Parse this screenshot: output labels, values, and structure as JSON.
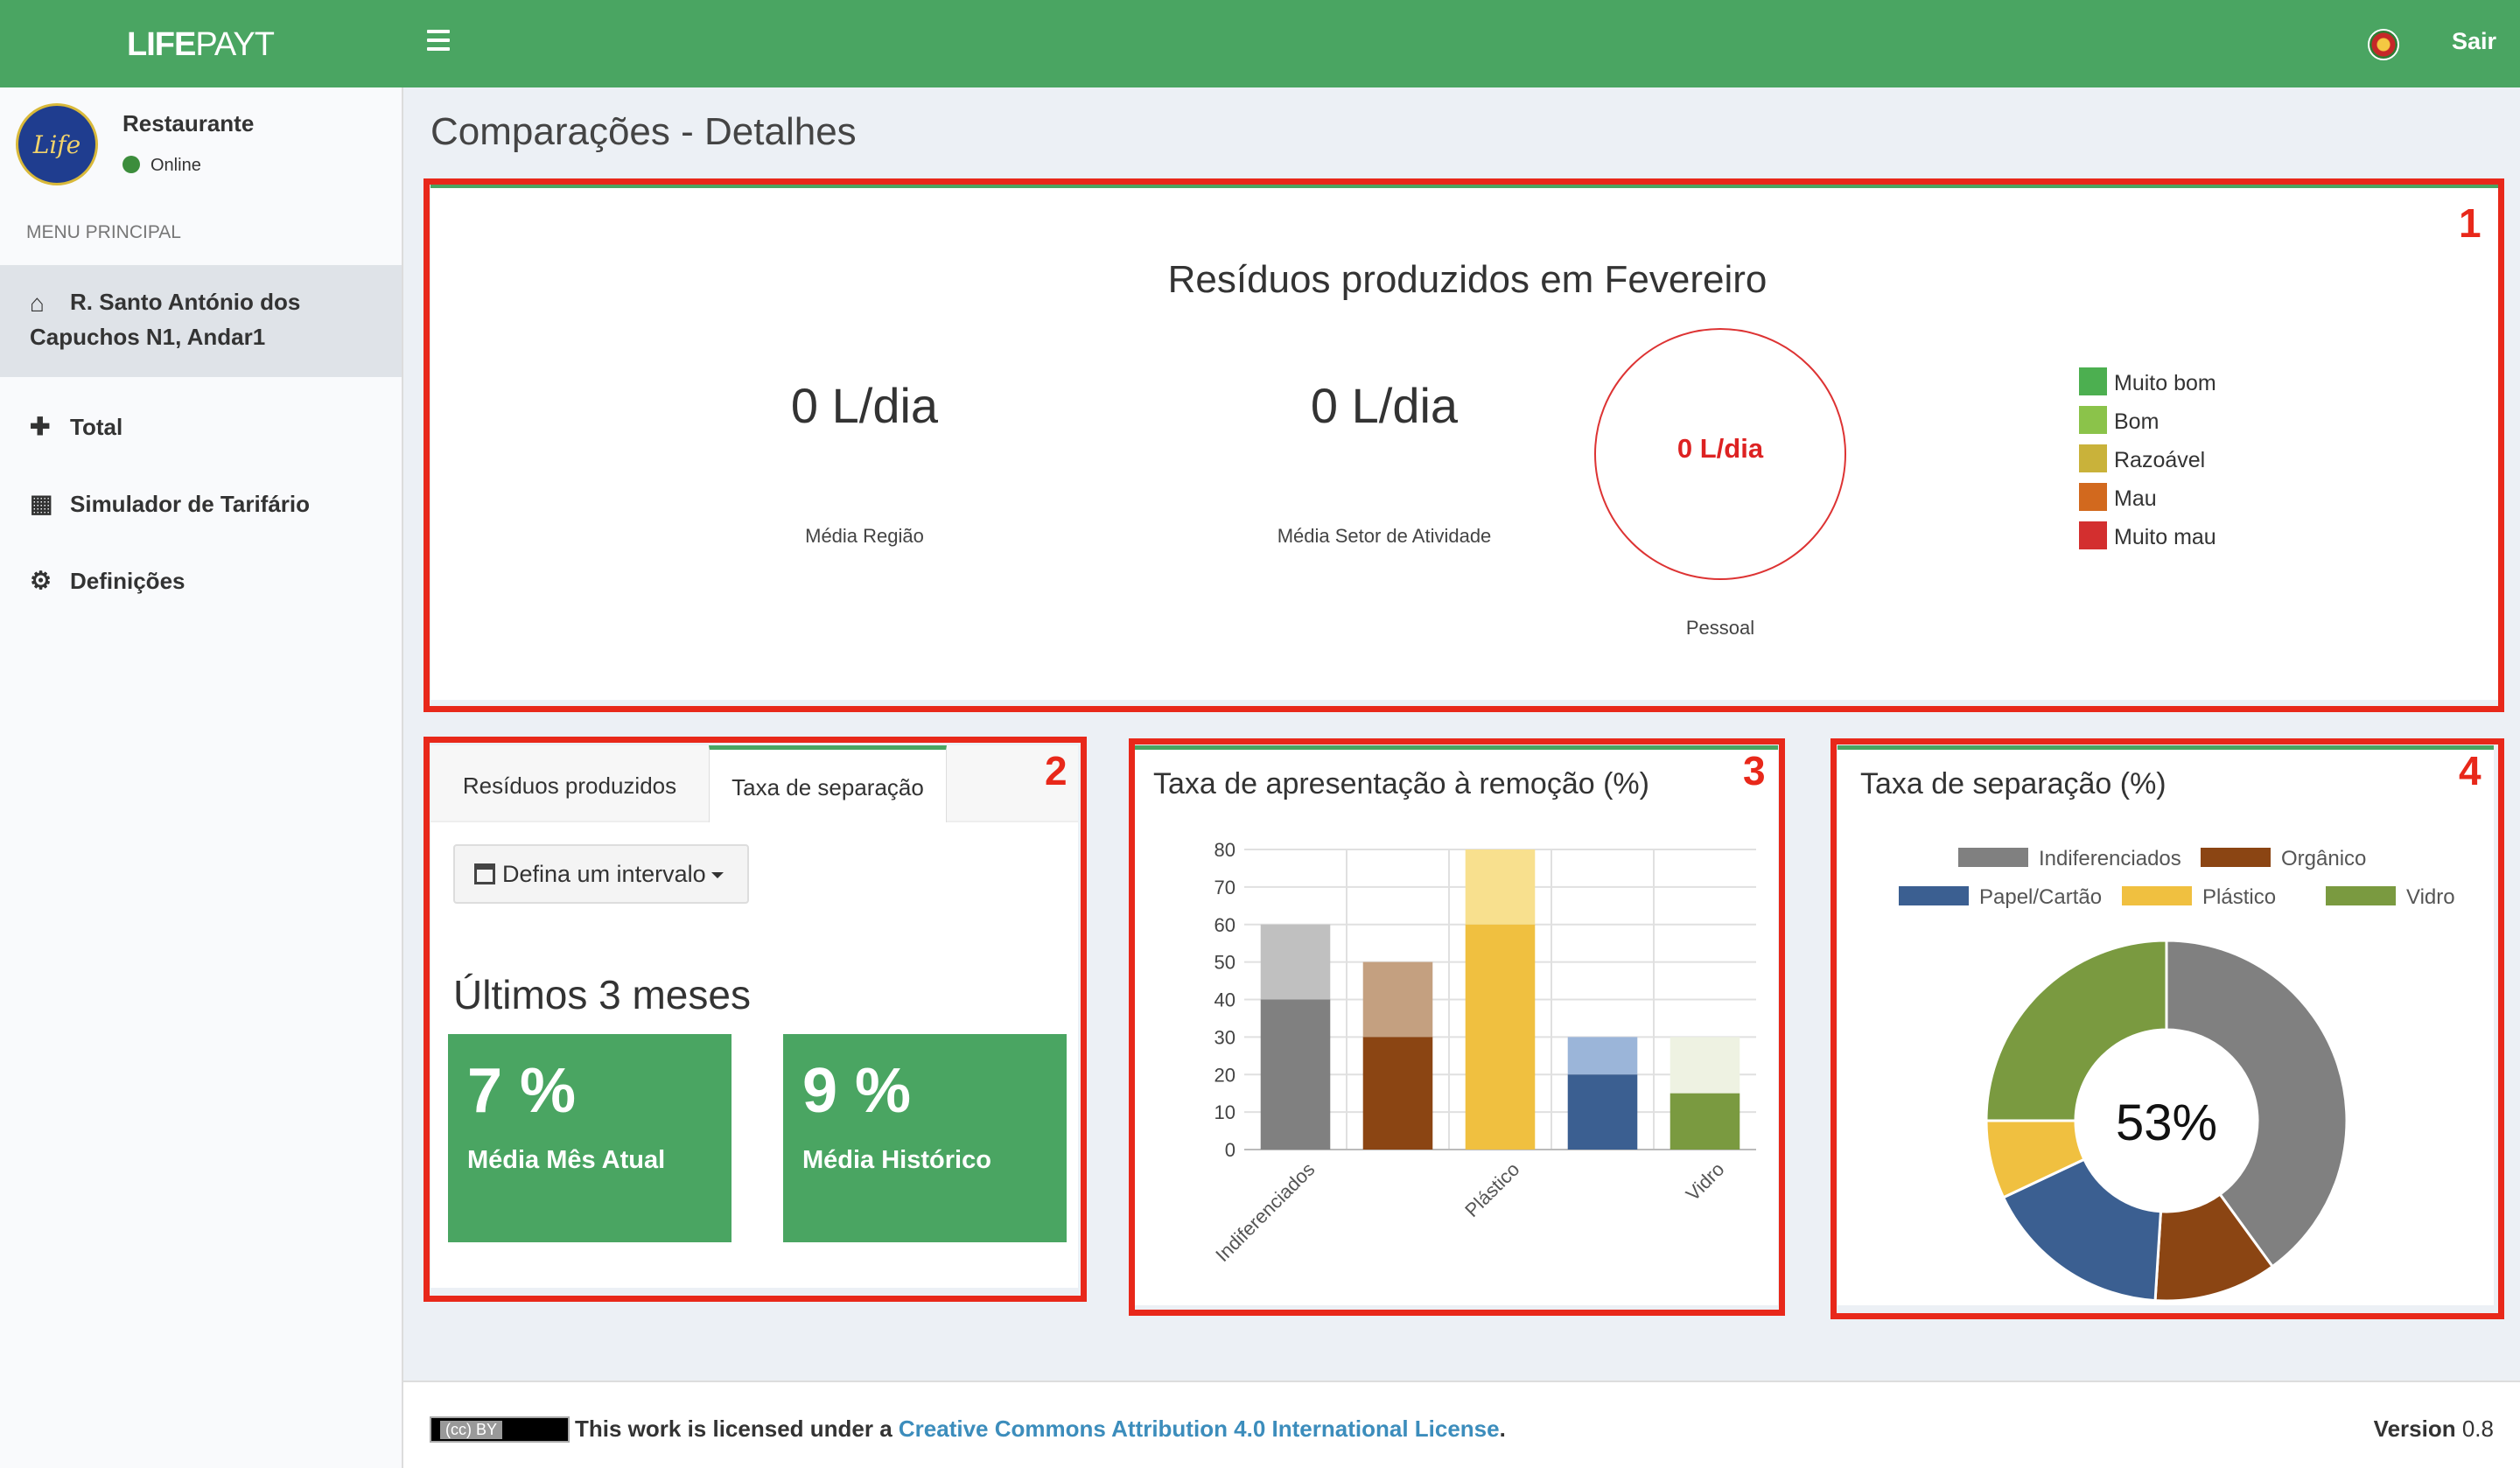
{
  "header": {
    "logo_bold": "LIFE",
    "logo_light": "PAYT",
    "logout": "Sair"
  },
  "user": {
    "name": "Restaurante",
    "status": "Online"
  },
  "sidebar": {
    "menu_header": "MENU PRINCIPAL",
    "items": [
      {
        "label_line1": "R. Santo António dos",
        "label_line2": "Capuchos N1, Andar1",
        "icon": "home-icon",
        "active": true
      },
      {
        "label": "Total",
        "icon": "plus-icon"
      },
      {
        "label": "Simulador de Tarifário",
        "icon": "calculator-icon"
      },
      {
        "label": "Definições",
        "icon": "cogs-icon"
      }
    ]
  },
  "page": {
    "title": "Comparações - Detalhes"
  },
  "annotations": [
    "1",
    "2",
    "3",
    "4"
  ],
  "waste_box": {
    "title": "Resíduos produzidos em Fevereiro",
    "region_value": "0 L/dia",
    "region_label": "Média Região",
    "sector_value": "0 L/dia",
    "sector_label": "Média Setor de Atividade",
    "personal_value": "0 L/dia",
    "personal_label": "Pessoal",
    "legend": [
      {
        "label": "Muito bom",
        "color": "#4caf50"
      },
      {
        "label": "Bom",
        "color": "#8bc34a"
      },
      {
        "label": "Razoável",
        "color": "#c9b23a"
      },
      {
        "label": "Mau",
        "color": "#d2691e"
      },
      {
        "label": "Muito mau",
        "color": "#d32f2f"
      }
    ]
  },
  "separation_box": {
    "tabs": [
      "Resíduos produzidos",
      "Taxa de separação"
    ],
    "active_tab": 1,
    "range_button": "Defina um intervalo",
    "period_title": "Últimos 3 meses",
    "current": {
      "value": "7 %",
      "label": "Média Mês Atual"
    },
    "history": {
      "value": "9 %",
      "label": "Média Histórico"
    }
  },
  "chart_data": [
    {
      "type": "bar",
      "title": "Taxa de apresentação à remoção (%)",
      "categories": [
        "Indiferenciados",
        "Orgânico",
        "Plástico",
        "Papel/Cartão",
        "Vidro"
      ],
      "tick_labels_shown": [
        "Indiferenciados",
        "Plástico",
        "Vidro"
      ],
      "y_ticks": [
        "80",
        "70",
        "60",
        "50",
        "40",
        "30",
        "20",
        "10",
        "0"
      ],
      "ylim": [
        0,
        80
      ],
      "series": [
        {
          "values": [
            40,
            30,
            60,
            20,
            15
          ],
          "colors": [
            "#808080",
            "#8b4513",
            "#f0c040",
            "#3b5f91",
            "#7a9a40"
          ]
        },
        {
          "values": [
            60,
            50,
            80,
            30,
            30
          ],
          "colors": [
            "#c0c0c0",
            "#c4a080",
            "#f8e08e",
            "#9bb5d9",
            "#eef2e2"
          ]
        }
      ],
      "grid": true
    },
    {
      "type": "pie",
      "title": "Taxa de separação (%)",
      "center_label": "53%",
      "slices": [
        {
          "name": "Indiferenciados",
          "value": 40,
          "color": "#808080"
        },
        {
          "name": "Orgânico",
          "value": 11,
          "color": "#8b4513"
        },
        {
          "name": "Papel/Cartão",
          "value": 17,
          "color": "#3b5f91"
        },
        {
          "name": "Plástico",
          "value": 7,
          "color": "#f0c040"
        },
        {
          "name": "Vidro",
          "value": 25,
          "color": "#7a9a40"
        }
      ],
      "legend_placement": "top"
    }
  ],
  "footer": {
    "license_prefix": "This work is licensed under a ",
    "license_link": "Creative Commons Attribution 4.0 International License",
    "license_suffix": ".",
    "version_label": "Version",
    "version_value": "0.8"
  }
}
